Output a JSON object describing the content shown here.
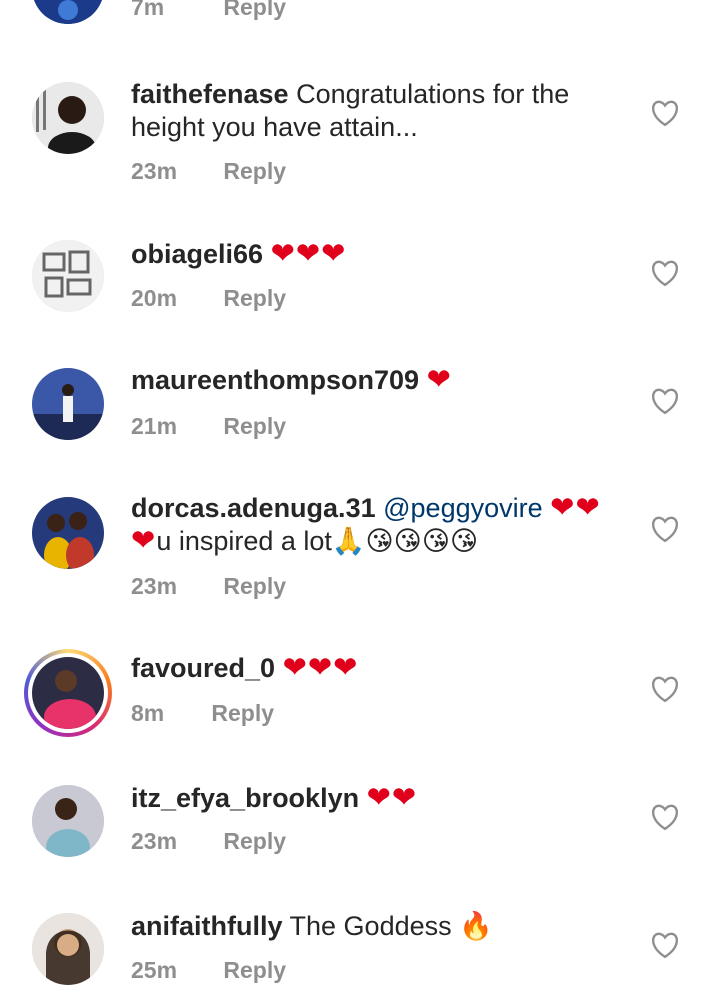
{
  "top_partial": {
    "time": "7m",
    "reply": "Reply"
  },
  "comments": [
    {
      "username": "faithefenase",
      "text": "Congratulations for the height you have attain...",
      "time": "23m",
      "reply": "Reply"
    },
    {
      "username": "obiageli66",
      "hearts": "❤❤❤",
      "time": "20m",
      "reply": "Reply"
    },
    {
      "username": "maureenthompson709",
      "hearts": "❤",
      "time": "21m",
      "reply": "Reply"
    },
    {
      "username": "dorcas.adenuga.31",
      "mention": "@peggyovire",
      "hearts": "❤❤",
      "line2_heart": "❤",
      "text": "u inspired a lot",
      "emoji": "🙏😘😘😘😘",
      "time": "23m",
      "reply": "Reply"
    },
    {
      "username": "favoured_0",
      "hearts": "❤❤❤",
      "time": "8m",
      "reply": "Reply"
    },
    {
      "username": "itz_efya_brooklyn",
      "hearts": "❤❤",
      "time": "23m",
      "reply": "Reply"
    },
    {
      "username": "anifaithfully",
      "text": "The Goddess",
      "emoji": "🔥",
      "time": "25m",
      "reply": "Reply"
    }
  ],
  "icons": {
    "like": "heart-outline-icon"
  },
  "colors": {
    "heart": "#e0001b",
    "mention": "#00376b",
    "meta": "#8e8e8e"
  }
}
